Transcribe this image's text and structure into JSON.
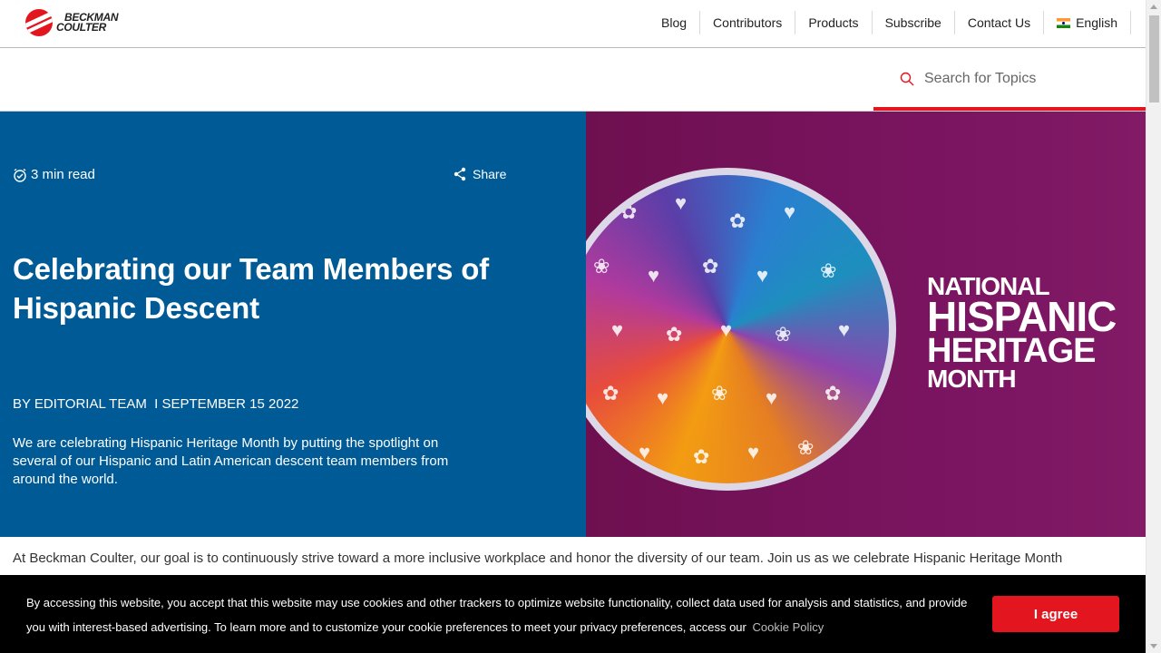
{
  "brand": {
    "logo_line1": "BECKMAN",
    "logo_line2": "COULTER",
    "accent_color": "#e3161f",
    "hero_blue": "#005a95"
  },
  "nav": {
    "items": [
      {
        "label": "Blog"
      },
      {
        "label": "Contributors"
      },
      {
        "label": "Products"
      },
      {
        "label": "Subscribe"
      },
      {
        "label": "Contact Us"
      }
    ],
    "language": "English",
    "language_icon": "india-flag-icon"
  },
  "search": {
    "placeholder": "Search for Topics",
    "icon": "search-icon"
  },
  "article": {
    "read_time": "3 min read",
    "share_label": "Share",
    "title": "Celebrating our Team Members of Hispanic Descent",
    "byline": "BY EDITORIAL TEAM  I SEPTEMBER 15 2022",
    "lede": "We are celebrating Hispanic Heritage Month by putting the spotlight on several of our Hispanic and Latin American descent team members from around the world.",
    "intro": "At Beckman Coulter, our goal is to continuously strive toward a more inclusive workplace and honor the diversity of our team. Join us as we celebrate Hispanic Heritage Month"
  },
  "hero_image": {
    "line1": "NATIONAL",
    "line2": "HISPANIC",
    "line3": "HERITAGE",
    "line4": "MONTH"
  },
  "cookie": {
    "text": "By accessing this website, you accept that this website may use cookies and other trackers to optimize website functionality, collect data used for analysis and statistics, and provide you with interest-based advertising. To learn more and to customize your cookie preferences to meet your privacy preferences, access our",
    "link": "Cookie Policy",
    "button": "I agree"
  }
}
